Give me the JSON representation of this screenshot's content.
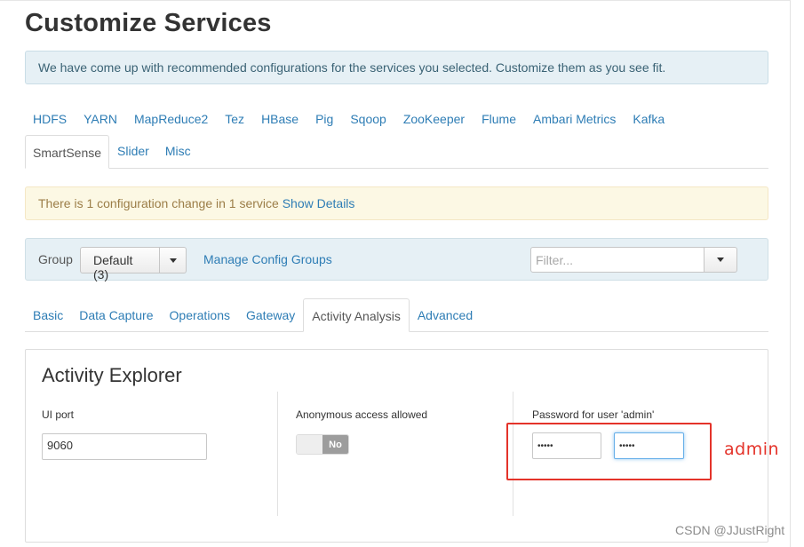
{
  "page": {
    "title": "Customize Services"
  },
  "info_alert": {
    "text": "We have come up with recommended configurations for the services you selected. Customize them as you see fit."
  },
  "service_tabs": {
    "row1": [
      "HDFS",
      "YARN",
      "MapReduce2",
      "Tez",
      "HBase",
      "Pig",
      "Sqoop",
      "ZooKeeper",
      "Flume",
      "Ambari Metrics",
      "Kafka"
    ],
    "row2": [
      "SmartSense",
      "Slider",
      "Misc"
    ],
    "active": "SmartSense"
  },
  "warning_alert": {
    "text": "There is 1 configuration change in 1 service",
    "link": "Show Details"
  },
  "group_bar": {
    "label": "Group",
    "selected": "Default (3)",
    "manage_link": "Manage Config Groups",
    "filter_placeholder": "Filter..."
  },
  "config_tabs": {
    "items": [
      "Basic",
      "Data Capture",
      "Operations",
      "Gateway",
      "Activity Analysis",
      "Advanced"
    ],
    "active": "Activity Analysis"
  },
  "activity_explorer": {
    "title": "Activity Explorer",
    "ui_port_label": "UI port",
    "ui_port_value": "9060",
    "anonymous_label": "Anonymous access allowed",
    "anonymous_toggle": "No",
    "password_label": "Password for user 'admin'",
    "password_value": "•••••",
    "password_confirm_value": "•••••"
  },
  "annotation": {
    "note": "admin",
    "color": "#e4332a"
  },
  "watermark": "CSDN @JJustRight",
  "colors": {
    "link": "#2e7db5",
    "info_bg": "#e6f0f5",
    "warning_bg": "#fcf8e4",
    "warning_text": "#9b7d47"
  }
}
